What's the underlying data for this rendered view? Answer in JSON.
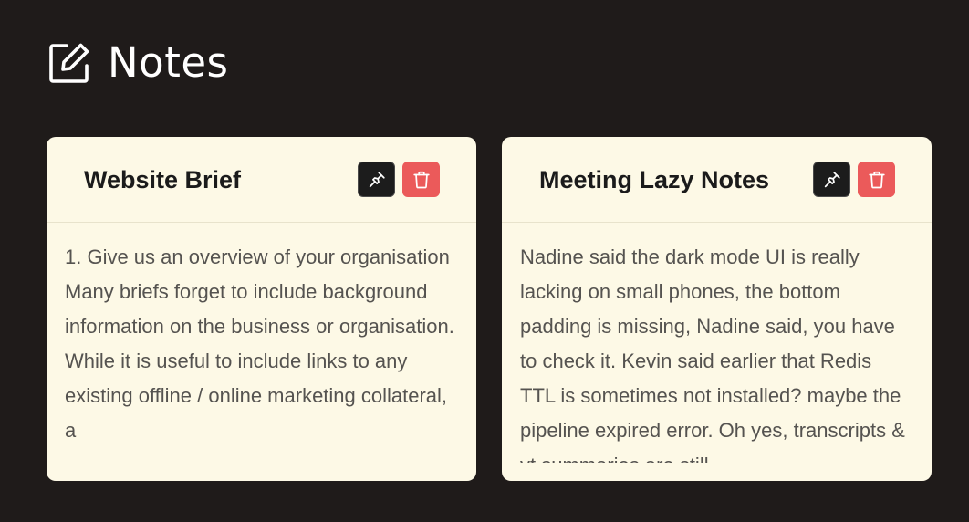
{
  "header": {
    "icon": "edit-icon",
    "title": "Notes"
  },
  "notes": [
    {
      "title": "Website Brief",
      "pin_icon": "pin-icon",
      "delete_icon": "trash-icon",
      "body": "1. Give us an overview of your organisation\nMany briefs forget to include background information on the business or organisation. While it is useful to include links to any existing offline / online marketing collateral, a"
    },
    {
      "title": "Meeting Lazy Notes",
      "pin_icon": "pin-icon",
      "delete_icon": "trash-icon",
      "body": "Nadine said the dark mode UI is really lacking on small phones, the bottom padding is missing, Nadine said, you have to check it. Kevin said earlier that Redis TTL is sometimes not installed? maybe the pipeline expired error. Oh yes, transcripts & yt summaries are still"
    }
  ],
  "colors": {
    "background": "#1f1b1a",
    "card": "#fdf9e6",
    "pin_button": "#1c1c1c",
    "delete_button": "#eb5a5a",
    "body_text": "#555350"
  }
}
